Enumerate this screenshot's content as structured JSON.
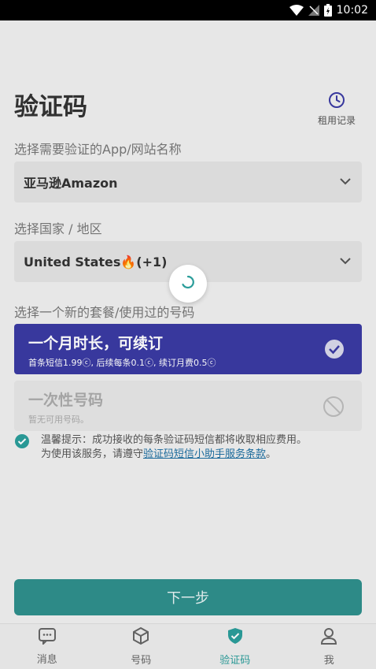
{
  "status_bar": {
    "time": "10:02"
  },
  "header": {
    "title": "验证码",
    "history_label": "租用记录"
  },
  "app_section": {
    "label": "选择需要验证的App/网站名称",
    "selected_value": "亚马逊Amazon"
  },
  "country_section": {
    "label": "选择国家 / 地区",
    "selected_value": "United States🔥(+1)"
  },
  "plan_section": {
    "label": "选择一个新的套餐/使用过的号码",
    "plans": [
      {
        "title": "一个月时长，可续订",
        "subtitle": "首条短信1.99ⓒ, 后续每条0.1ⓒ, 续订月费0.5ⓒ",
        "state": "selected"
      },
      {
        "title": "一次性号码",
        "subtitle": "暂无可用号码。",
        "state": "disabled"
      }
    ]
  },
  "notice": {
    "line1": "温馨提示：成功接收的每条验证码短信都将收取相应费用。",
    "line2_prefix": "为使用该服务，请遵守",
    "link_text": "验证码短信小助手服务条款",
    "line2_suffix": "。"
  },
  "next_button": {
    "label": "下一步"
  },
  "tabbar": {
    "tabs": [
      {
        "label": "消息",
        "icon": "message-icon"
      },
      {
        "label": "号码",
        "icon": "box-icon"
      },
      {
        "label": "验证码",
        "icon": "shield-check-icon",
        "active": true
      },
      {
        "label": "我",
        "icon": "user-icon"
      }
    ]
  },
  "colors": {
    "accent": "#2f8f8c",
    "selected_plan": "#3a3aa3",
    "link": "#1c6ea0"
  }
}
